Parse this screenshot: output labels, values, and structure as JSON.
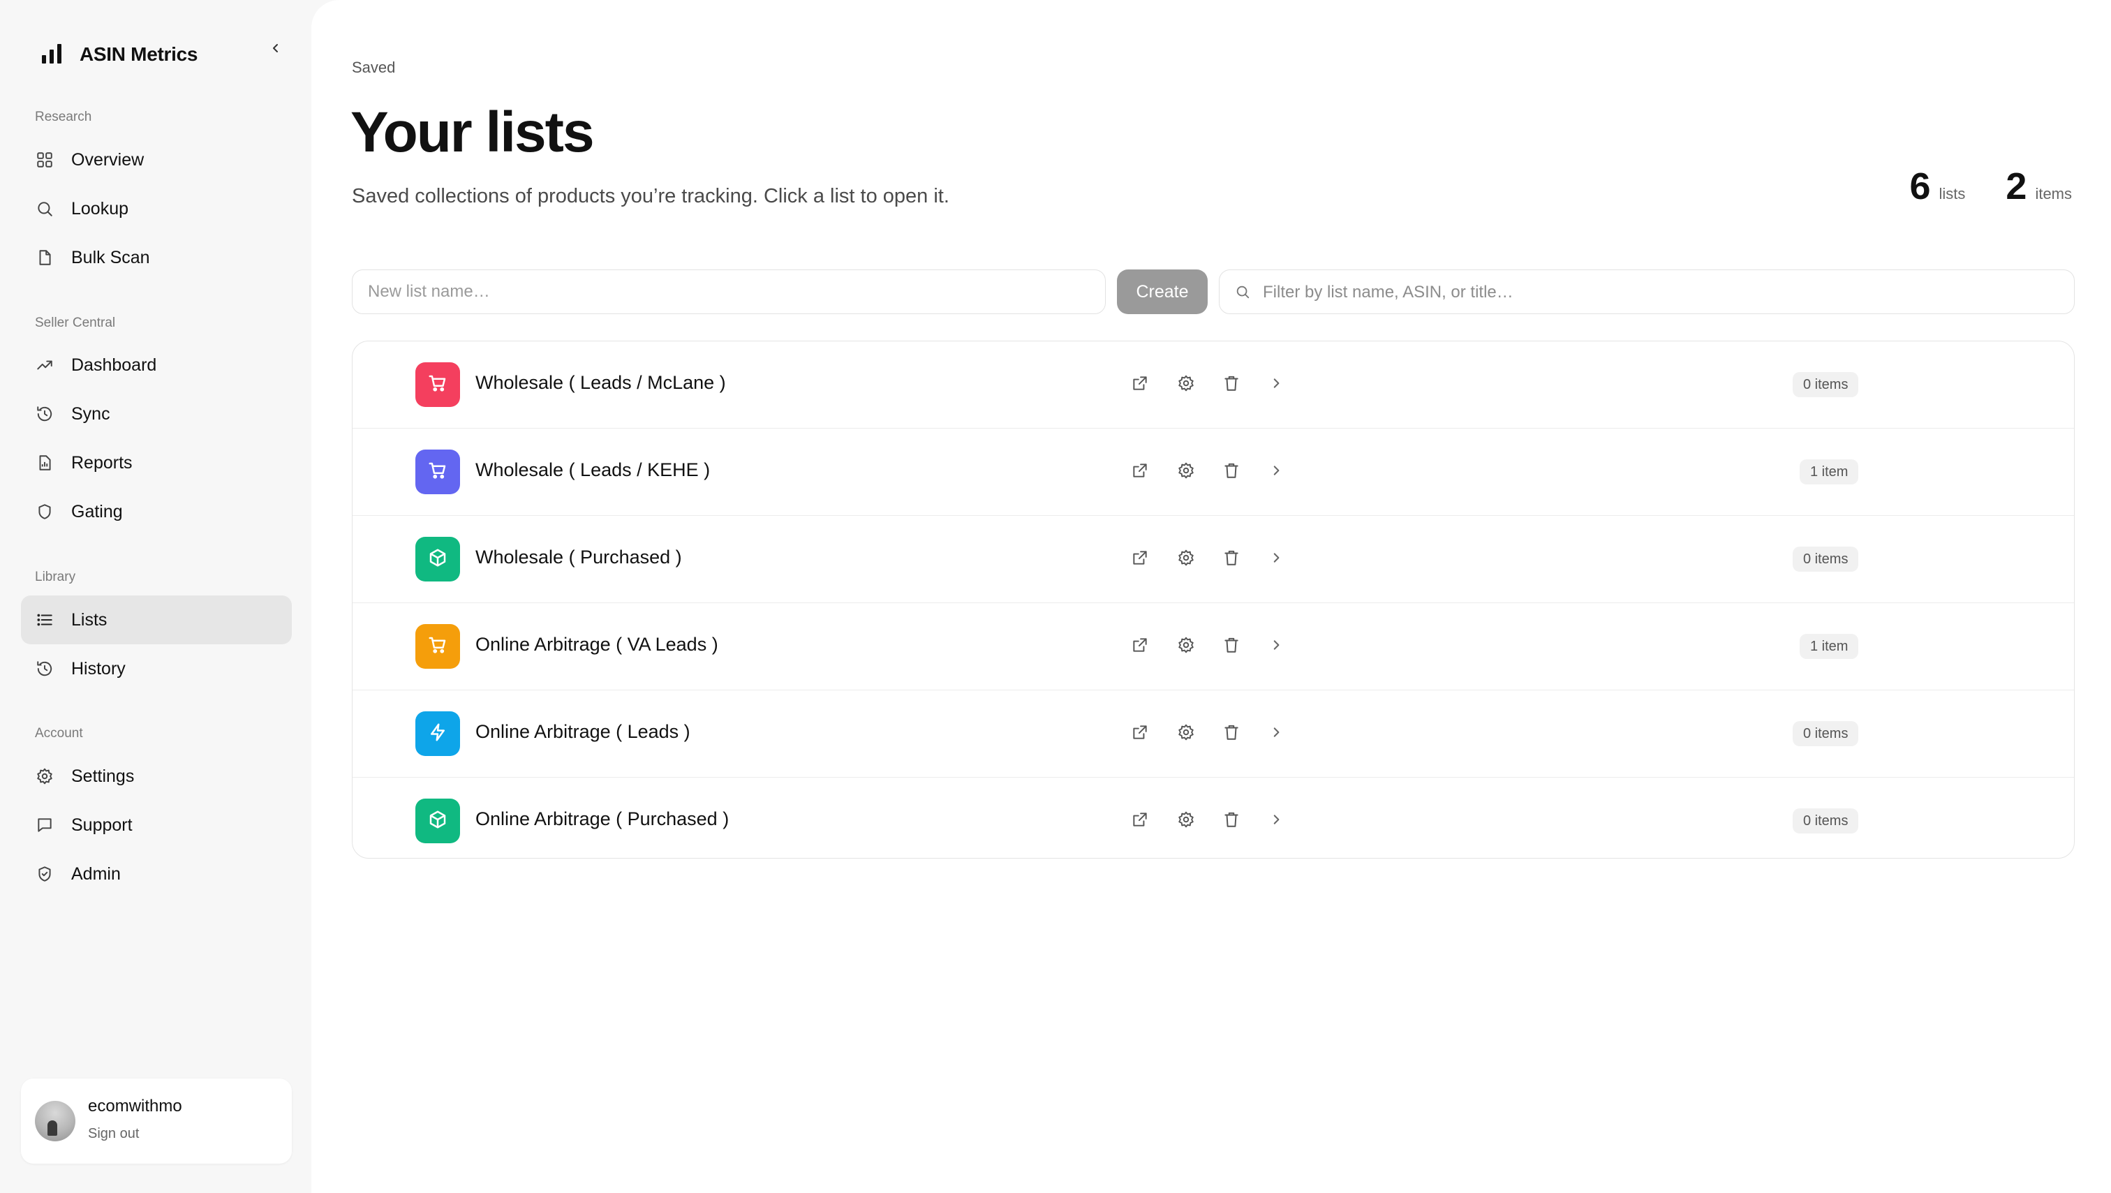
{
  "sidebar": {
    "brand": {
      "name": "ASIN Metrics",
      "icon": "bar-chart-icon"
    },
    "sections": [
      {
        "label": "Research",
        "items": [
          {
            "label": "Overview",
            "icon": "grid-icon"
          },
          {
            "label": "Lookup",
            "icon": "search-icon"
          },
          {
            "label": "Bulk Scan",
            "icon": "file-icon"
          }
        ]
      },
      {
        "label": "Seller Central",
        "items": [
          {
            "label": "Dashboard",
            "icon": "trending-up-icon"
          },
          {
            "label": "Sync",
            "icon": "history-icon"
          },
          {
            "label": "Reports",
            "icon": "report-icon"
          },
          {
            "label": "Gating",
            "icon": "shield-icon"
          }
        ]
      },
      {
        "label": "Library",
        "items": [
          {
            "label": "Lists",
            "icon": "list-icon",
            "active": true
          },
          {
            "label": "History",
            "icon": "history-icon"
          }
        ]
      },
      {
        "label": "Account",
        "items": [
          {
            "label": "Settings",
            "icon": "gear-icon"
          },
          {
            "label": "Support",
            "icon": "message-icon"
          },
          {
            "label": "Admin",
            "icon": "shield-check-icon"
          }
        ]
      }
    ],
    "user": {
      "name": "ecomwithmo",
      "sign_out": "Sign out"
    }
  },
  "main": {
    "eyebrow": "Saved",
    "title": "Your lists",
    "subtitle": "Saved collections of products you’re tracking. Click a list to open it.",
    "stats": {
      "lists_count": "6",
      "lists_unit": "lists",
      "items_count": "2",
      "items_unit": "items"
    },
    "new_list_placeholder": "New list name…",
    "create_label": "Create",
    "filter_placeholder": "Filter by list name, ASIN, or title…",
    "lists": [
      {
        "name": "Wholesale ( Leads / McLane )",
        "count": "0 items",
        "icon": "cart-icon",
        "color": "#f43f5e"
      },
      {
        "name": "Wholesale ( Leads / KEHE )",
        "count": "1 item",
        "icon": "cart-icon",
        "color": "#6366f1"
      },
      {
        "name": "Wholesale ( Purchased )",
        "count": "0 items",
        "icon": "box-icon",
        "color": "#10b981"
      },
      {
        "name": "Online Arbitrage ( VA Leads )",
        "count": "1 item",
        "icon": "cart-icon",
        "color": "#f59e0b"
      },
      {
        "name": "Online Arbitrage ( Leads )",
        "count": "0 items",
        "icon": "bolt-icon",
        "color": "#0ea5e9"
      },
      {
        "name": "Online Arbitrage ( Purchased )",
        "count": "0 items",
        "icon": "box-icon",
        "color": "#10b981"
      }
    ]
  }
}
